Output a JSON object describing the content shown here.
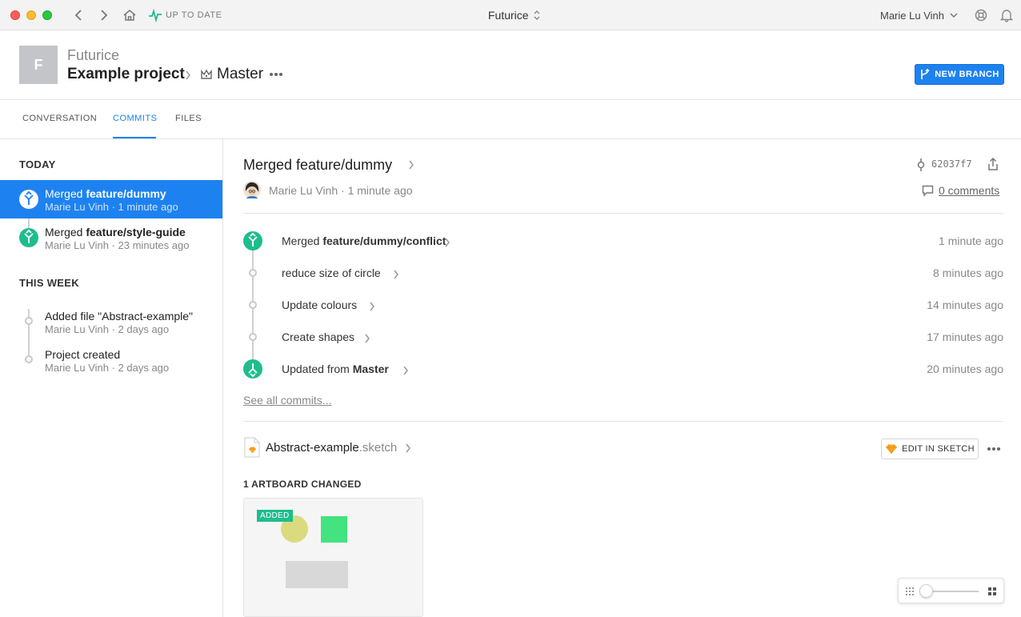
{
  "titlebar": {
    "status": "UP TO DATE",
    "app_title": "Futurice",
    "user_name": "Marie Lu Vinh"
  },
  "header": {
    "avatar_letter": "F",
    "org_name": "Futurice",
    "project_name": "Example project",
    "branch_name": "Master",
    "new_branch_label": "NEW BRANCH"
  },
  "tabs": [
    {
      "label": "CONVERSATION"
    },
    {
      "label": "COMMITS",
      "active": true
    },
    {
      "label": "FILES"
    }
  ],
  "sidebar": {
    "today_title": "TODAY",
    "today_items": [
      {
        "prefix": "Merged ",
        "bold": "feature/dummy",
        "sub": "Marie Lu Vinh · 1 minute ago"
      },
      {
        "prefix": "Merged ",
        "bold": "feature/style-guide",
        "sub": "Marie Lu Vinh · 23 minutes ago"
      }
    ],
    "week_title": "THIS WEEK",
    "week_items": [
      {
        "title": "Added file \"Abstract-example\"",
        "sub": "Marie Lu Vinh · 2 days ago"
      },
      {
        "title": "Project created",
        "sub": "Marie Lu Vinh · 2 days ago"
      }
    ]
  },
  "main": {
    "commit_title": "Merged feature/dummy",
    "hash": "62037f7",
    "author_line": "Marie Lu Vinh · 1 minute ago",
    "comments": "0 comments",
    "commits": [
      {
        "prefix": "Merged ",
        "bold": "feature/dummy/conflict",
        "time": "1 minute ago"
      },
      {
        "prefix": "reduce size of circle",
        "bold": "",
        "time": "8 minutes ago"
      },
      {
        "prefix": "Update colours",
        "bold": "",
        "time": "14 minutes ago"
      },
      {
        "prefix": "Create shapes",
        "bold": "",
        "time": "17 minutes ago"
      },
      {
        "prefix": "Updated from ",
        "bold": "Master",
        "time": "20 minutes ago"
      }
    ],
    "see_all": "See all commits...",
    "file_base": "Abstract-example",
    "file_ext": ".sketch",
    "edit_sketch": "EDIT IN SKETCH",
    "artboards_changed": "1 ARTBOARD CHANGED",
    "added_badge": "ADDED"
  },
  "colors": {
    "accent": "#1d82f0",
    "merge_green": "#1dbd8e"
  }
}
